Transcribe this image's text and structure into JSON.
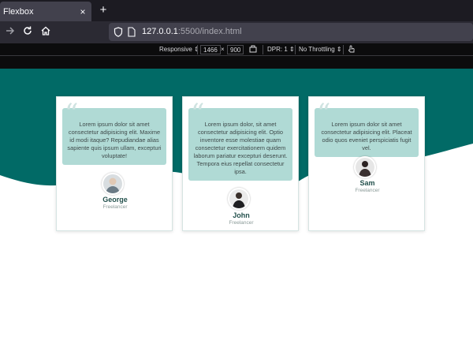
{
  "browser": {
    "tab_title": "Flexbox",
    "tab_close": "×",
    "new_tab": "+",
    "url_host": "127.0.0.1",
    "url_rest": ":5500/index.html"
  },
  "devtools": {
    "device": "Responsive",
    "width": "1466",
    "times": "×",
    "height": "900",
    "dpr": "DPR: 1",
    "throttling": "No Throttling"
  },
  "colors": {
    "hero": "#016a66",
    "quote_box": "#b0dad5",
    "name": "#24514d"
  },
  "testimonials": [
    {
      "quote_mark": "“",
      "text": "Lorem ipsum dolor sit amet consectetur adipisicing elit. Maxime id modi itaque? Repudiandae alias sapiente quis ipsum ullam, excepturi voluptate!",
      "name": "George",
      "role": "Freelancer"
    },
    {
      "quote_mark": "“",
      "text": "Lorem ipsum dolor, sit amet consectetur adipisicing elit. Optio inventore esse molestiae quam consectetur exercitationem quidem laborum pariatur excepturi deserunt. Tempora eius repellat consectetur ipsa.",
      "name": "John",
      "role": "Freelancer"
    },
    {
      "quote_mark": "“",
      "text": "Lorem ipsum dolor sit amet consectetur adipisicing elit. Placeat odio quos eveniet perspiciatis fugit vel.",
      "name": "Sam",
      "role": "Freelancer"
    }
  ]
}
